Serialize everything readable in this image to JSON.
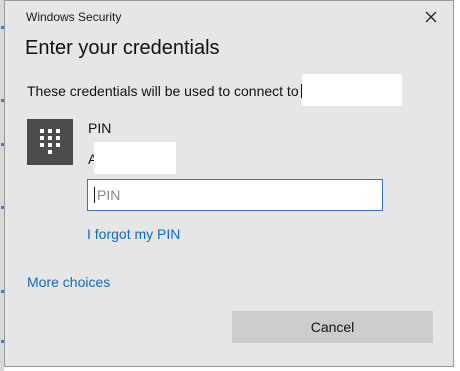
{
  "dialog": {
    "title": "Windows Security",
    "heading": "Enter your credentials",
    "description": "These credentials will be used to connect to",
    "pin_label": "PIN",
    "username_initial": "A",
    "pin_input": {
      "value": "",
      "placeholder": "PIN"
    },
    "forgot_pin_link": "I forgot my PIN",
    "more_choices_link": "More choices",
    "cancel_label": "Cancel"
  },
  "icons": {
    "close": "close-icon",
    "pin_tile": "keypad-icon"
  },
  "colors": {
    "dialog_bg": "#e6e6e6",
    "link": "#0b6cc4",
    "input_border": "#3a73c8",
    "cancel_bg": "#cccccc",
    "pin_tile_bg": "#4b4b4b"
  }
}
